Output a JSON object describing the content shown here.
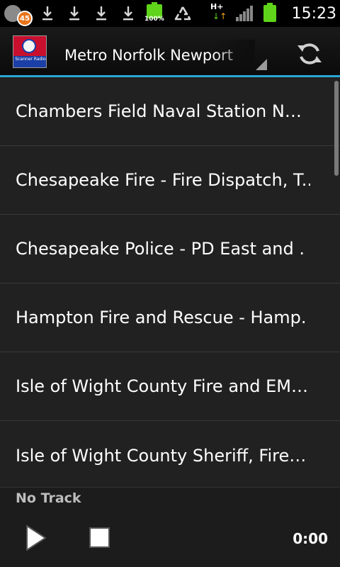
{
  "status_bar": {
    "notification_count": "45",
    "battery_percent": "100%",
    "network_type": "H+",
    "time": "15:23",
    "icons": [
      "notification-badge-icon",
      "download-icon",
      "download-icon",
      "download-icon",
      "download-icon",
      "battery-icon",
      "recycle-icon",
      "network-icon",
      "signal-icon",
      "battery-icon"
    ]
  },
  "action_bar": {
    "app_logo_text": "Scanner Radio",
    "selected_location": "Metro Norfolk Newport",
    "refresh_icon": "refresh-icon"
  },
  "feeds": [
    {
      "label": "Chambers Field Naval Station N…"
    },
    {
      "label": "Chesapeake Fire -  Fire Dispatch, T.."
    },
    {
      "label": "Chesapeake Police  -  PD East and ."
    },
    {
      "label": "Hampton Fire and Rescue -  Hamp."
    },
    {
      "label": "Isle of Wight County Fire and EM…"
    },
    {
      "label": "Isle of Wight County Sheriff, Fire…"
    }
  ],
  "player": {
    "track": "No Track",
    "elapsed": "0:00",
    "play_icon": "play-icon",
    "stop_icon": "stop-icon"
  },
  "colors": {
    "accent": "#2aa6d6",
    "list_bg": "#212121",
    "divider": "#3a3a3a",
    "battery": "#5fd41a"
  }
}
